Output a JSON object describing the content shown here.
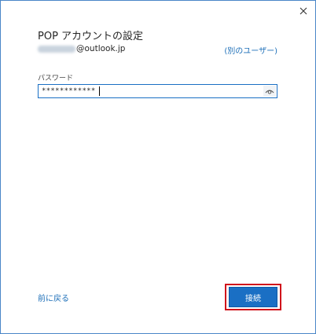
{
  "dialog": {
    "title": "POP アカウントの設定",
    "email": "@outlook.jp",
    "other_user_link": "(別のユーザー)",
    "password_label": "パスワード",
    "password_value": "************",
    "back_link": "前に戻る",
    "connect_button": "接続"
  },
  "colors": {
    "accent": "#1a6fc4",
    "link": "#1d6fb8",
    "highlight": "#d0121b"
  },
  "icons": {
    "close": "close-icon",
    "reveal_password": "eye-icon"
  }
}
